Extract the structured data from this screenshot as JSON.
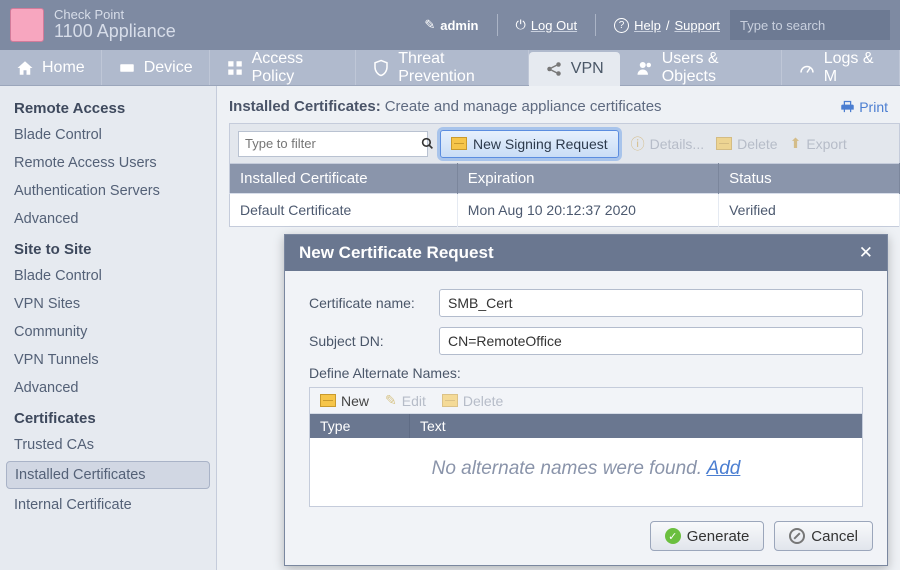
{
  "brand": {
    "line1": "Check Point",
    "line2": "1100 Appliance"
  },
  "topbar": {
    "user": "admin",
    "logout": "Log Out",
    "help": "Help",
    "support": "Support",
    "search_placeholder": "Type to search"
  },
  "tabs": {
    "home": "Home",
    "device": "Device",
    "access": "Access Policy",
    "threat": "Threat Prevention",
    "vpn": "VPN",
    "users": "Users & Objects",
    "logs": "Logs & M"
  },
  "sidebar": {
    "g1": {
      "title": "Remote Access",
      "items": [
        "Blade Control",
        "Remote Access Users",
        "Authentication Servers",
        "Advanced"
      ]
    },
    "g2": {
      "title": "Site to Site",
      "items": [
        "Blade Control",
        "VPN Sites",
        "Community",
        "VPN Tunnels",
        "Advanced"
      ]
    },
    "g3": {
      "title": "Certificates",
      "items": [
        "Trusted CAs",
        "Installed Certificates",
        "Internal Certificate"
      ],
      "selected_index": 1
    }
  },
  "page": {
    "title": "Installed Certificates:",
    "subtitle": "Create and manage appliance certificates",
    "print": "Print"
  },
  "toolbar": {
    "filter_placeholder": "Type to filter",
    "new_signing": "New Signing Request",
    "details": "Details...",
    "delete": "Delete",
    "export": "Export"
  },
  "table": {
    "headers": {
      "c1": "Installed Certificate",
      "c2": "Expiration",
      "c3": "Status"
    },
    "rows": [
      {
        "c1": "Default Certificate",
        "c2": "Mon Aug 10 20:12:37 2020",
        "c3": "Verified"
      }
    ]
  },
  "modal": {
    "title": "New Certificate Request",
    "cert_name_label": "Certificate name:",
    "cert_name_value": "SMB_Cert",
    "subject_dn_label": "Subject DN:",
    "subject_dn_value": "CN=RemoteOffice",
    "alt_names_label": "Define Alternate Names:",
    "inner_toolbar": {
      "new": "New",
      "edit": "Edit",
      "delete": "Delete"
    },
    "inner_headers": {
      "type": "Type",
      "text": "Text"
    },
    "empty_text": "No alternate names were found. ",
    "empty_link": "Add",
    "generate": "Generate",
    "cancel": "Cancel"
  }
}
